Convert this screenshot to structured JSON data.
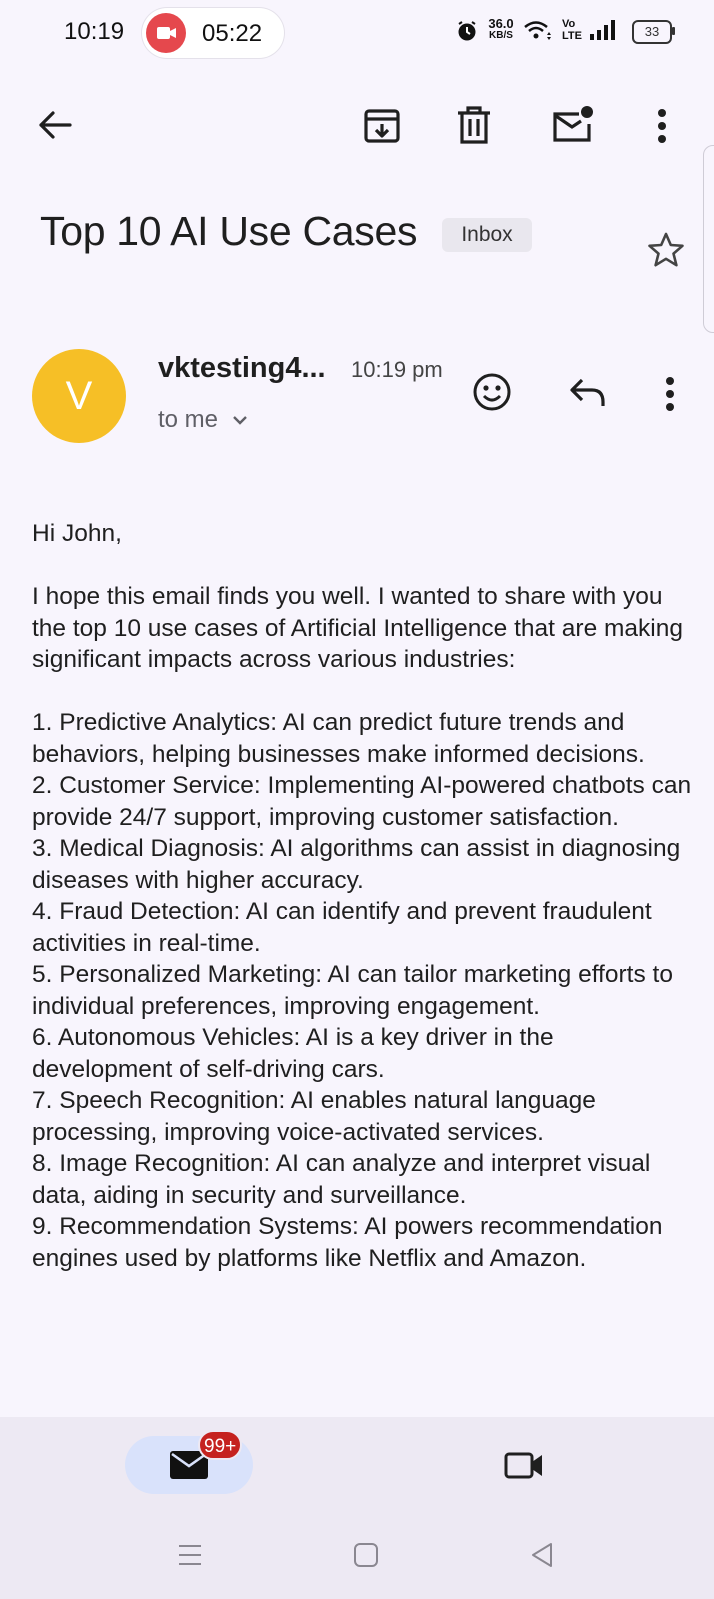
{
  "status_bar": {
    "time": "10:19",
    "recording_time": "05:22",
    "net_speed_value": "36.0",
    "net_speed_unit": "KB/S",
    "volte_top": "Vo",
    "volte_bottom": "LTE",
    "battery": "33"
  },
  "email": {
    "subject": "Top 10 AI Use Cases",
    "label": "Inbox",
    "sender_initial": "V",
    "sender": "vktesting4...",
    "time": "10:19 pm",
    "recipient": "to me",
    "greeting": "Hi John,",
    "intro": "I hope this email finds you well. I wanted to share with you the top 10 use cases of Artificial Intelligence that are making significant impacts across various industries:",
    "items": [
      "1. Predictive Analytics: AI can predict future trends and behaviors, helping businesses make informed decisions.",
      "2. Customer Service: Implementing AI-powered chatbots can provide 24/7 support, improving customer satisfaction.",
      "3. Medical Diagnosis: AI algorithms can assist in diagnosing diseases with higher accuracy.",
      "4. Fraud Detection: AI can identify and prevent fraudulent activities in real-time.",
      "5. Personalized Marketing: AI can tailor marketing efforts to individual preferences, improving engagement.",
      "6. Autonomous Vehicles: AI is a key driver in the development of self-driving cars.",
      "7. Speech Recognition: AI enables natural language processing, improving voice-activated services.",
      "8. Image Recognition: AI can analyze and interpret visual data, aiding in security and surveillance.",
      "9. Recommendation Systems: AI powers recommendation engines used by platforms like Netflix and Amazon."
    ]
  },
  "bottom_nav": {
    "mail_badge": "99+"
  },
  "colors": {
    "avatar": "#f6bf26",
    "badge": "#c5221f",
    "active_pill": "#d9e2fb",
    "recording": "#e5484d"
  }
}
